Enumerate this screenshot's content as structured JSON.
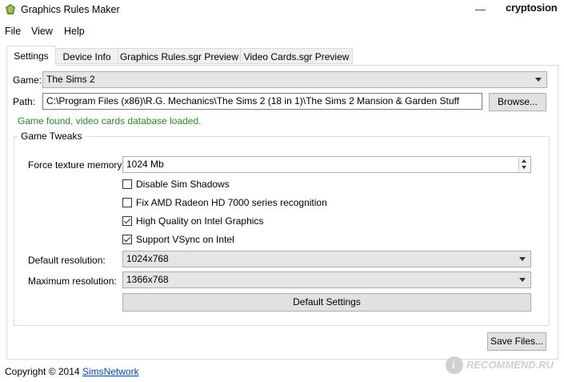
{
  "window": {
    "title": "Graphics Rules Maker",
    "watermark": "cryptosion"
  },
  "menu": [
    "File",
    "View",
    "Help"
  ],
  "tabs": [
    "Settings",
    "Device Info",
    "Graphics Rules.sgr Preview",
    "Video Cards.sgr Preview"
  ],
  "settings": {
    "game_label": "Game:",
    "game_value": "The Sims 2",
    "path_label": "Path:",
    "path_value": "C:\\Program Files (x86)\\R.G. Mechanics\\The Sims 2 (18 in 1)\\The Sims 2 Mansion & Garden Stuff",
    "browse_label": "Browse...",
    "status_text": "Game found, video cards database loaded.",
    "status_color": "#2a8a2a"
  },
  "tweaks": {
    "group_label": "Game Tweaks",
    "texture_label": "Force texture memory:",
    "texture_value": "1024 Mb",
    "checkboxes": [
      {
        "label": "Disable Sim Shadows",
        "checked": false
      },
      {
        "label": "Fix AMD Radeon HD 7000 series recognition",
        "checked": false
      },
      {
        "label": "High Quality on Intel Graphics",
        "checked": true
      },
      {
        "label": "Support VSync on Intel",
        "checked": true
      }
    ],
    "default_res_label": "Default resolution:",
    "default_res_value": "1024x768",
    "max_res_label": "Maximum resolution:",
    "max_res_value": "1366x768",
    "default_settings_label": "Default Settings"
  },
  "save_label": "Save Files...",
  "footer": {
    "copyright": "Copyright © 2014",
    "link": "SimsNetwork"
  },
  "overlay": {
    "recommend_text": "RECOMMEND.RU",
    "recommend_badge": "i"
  }
}
